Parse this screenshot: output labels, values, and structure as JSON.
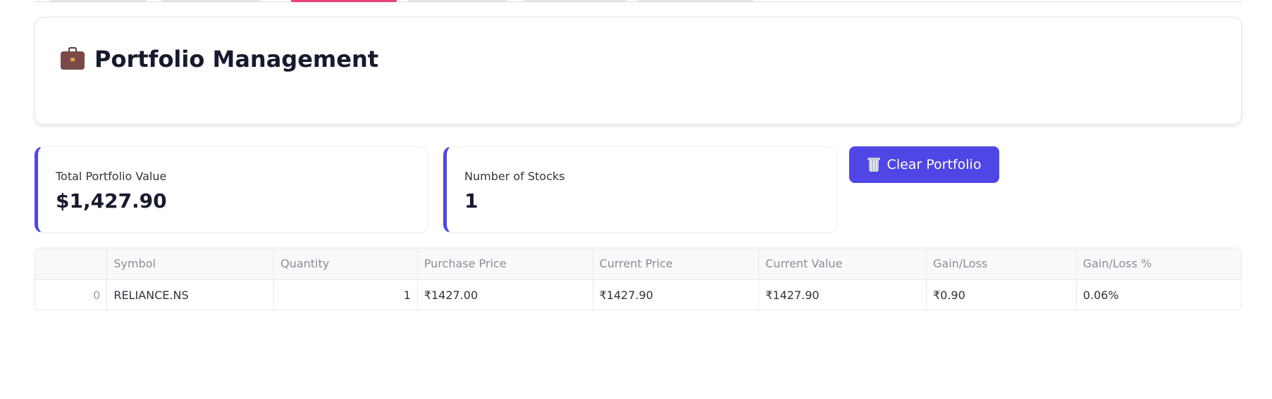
{
  "tabs": [
    {
      "label": ""
    },
    {
      "label": ""
    },
    {
      "label": "",
      "active": true
    },
    {
      "label": ""
    },
    {
      "label": ""
    },
    {
      "label": ""
    }
  ],
  "header": {
    "icon": "briefcase-icon",
    "title": "Portfolio Management"
  },
  "metrics": {
    "total_value": {
      "label": "Total Portfolio Value",
      "value": "$1,427.90"
    },
    "stock_count": {
      "label": "Number of Stocks",
      "value": "1"
    }
  },
  "actions": {
    "clear_icon": "wastebasket-icon",
    "clear_label": "Clear Portfolio"
  },
  "table": {
    "columns": [
      "",
      "Symbol",
      "Quantity",
      "Purchase Price",
      "Current Price",
      "Current Value",
      "Gain/Loss",
      "Gain/Loss %"
    ],
    "rows": [
      {
        "index": "0",
        "symbol": "RELIANCE.NS",
        "quantity": "1",
        "purchase_price": "₹1427.00",
        "current_price": "₹1427.90",
        "current_value": "₹1427.90",
        "gain_loss": "₹0.90",
        "gain_loss_pct": "0.06%"
      }
    ]
  },
  "colors": {
    "accent": "#4f46e5",
    "active_tab": "#e8417a",
    "title_text": "#171a2e"
  }
}
